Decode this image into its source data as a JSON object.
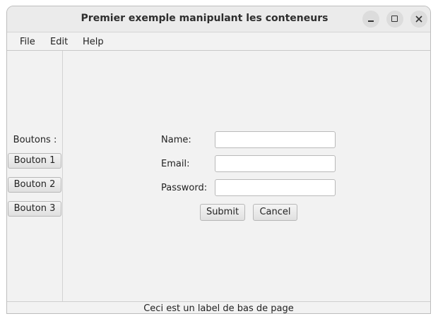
{
  "window": {
    "title": "Premier exemple manipulant les conteneurs"
  },
  "menu": {
    "file": "File",
    "edit": "Edit",
    "help": "Help"
  },
  "sidebar": {
    "label": "Boutons :",
    "buttons": [
      "Bouton 1",
      "Bouton 2",
      "Bouton 3"
    ]
  },
  "form": {
    "name_label": "Name:",
    "name_value": "",
    "email_label": "Email:",
    "email_value": "",
    "password_label": "Password:",
    "password_value": "",
    "submit_label": "Submit",
    "cancel_label": "Cancel"
  },
  "status": {
    "text": "Ceci est un label de bas de page"
  },
  "colors": {
    "window_bg": "#f2f2f2",
    "titlebar_bg": "#ebebeb"
  },
  "icons": {
    "minimize": "minimize-icon",
    "maximize": "maximize-icon",
    "close": "close-icon"
  }
}
